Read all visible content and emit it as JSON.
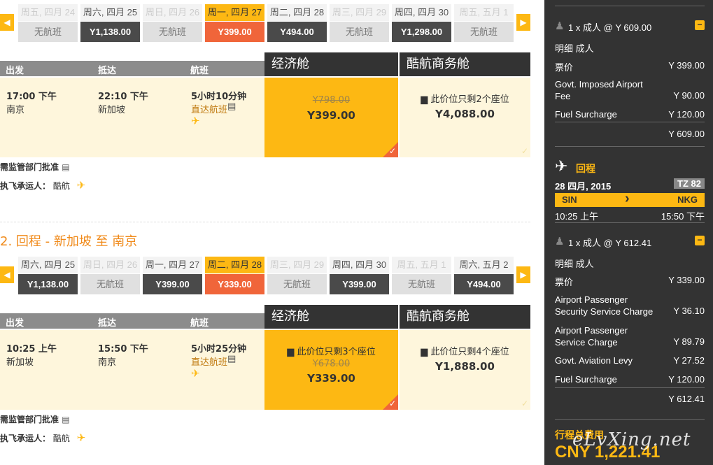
{
  "outbound": {
    "dates": [
      {
        "label": "周五, 四月 24",
        "value": "无航班",
        "state": "none"
      },
      {
        "label": "周六, 四月 25",
        "value": "Y1,138.00",
        "state": "fare"
      },
      {
        "label": "周日, 四月 26",
        "value": "无航班",
        "state": "none"
      },
      {
        "label": "周一, 四月 27",
        "value": "Y399.00",
        "state": "selected"
      },
      {
        "label": "周二, 四月 28",
        "value": "Y494.00",
        "state": "fare"
      },
      {
        "label": "周三, 四月 29",
        "value": "无航班",
        "state": "none"
      },
      {
        "label": "周四, 四月 30",
        "value": "Y1,298.00",
        "state": "fare"
      },
      {
        "label": "周五, 五月 1",
        "value": "无航班",
        "state": "none"
      }
    ],
    "headers": {
      "depart": "出发",
      "arrive": "抵达",
      "flight": "航班"
    },
    "cabins": {
      "economy": "经济舱",
      "business": "酷航商务舱"
    },
    "flight": {
      "depart_time": "17:00 下午",
      "depart_city": "南京",
      "arrive_time": "22:10 下午",
      "arrive_city": "新加坡",
      "duration": "5小时10分钟",
      "type": "直达航班"
    },
    "economy": {
      "old_price": "Y798.00",
      "price": "Y399.00"
    },
    "business": {
      "seats": "此价位只剩2个座位",
      "price": "Y4,088.00"
    },
    "approval": "需监管部门批准",
    "carrier_label": "执飞承运人：",
    "carrier": "酷航"
  },
  "return_section": {
    "title": "2. 回程 - 新加坡 至 南京"
  },
  "inbound": {
    "dates": [
      {
        "label": "周六, 四月 25",
        "value": "Y1,138.00",
        "state": "fare"
      },
      {
        "label": "周日, 四月 26",
        "value": "无航班",
        "state": "none"
      },
      {
        "label": "周一, 四月 27",
        "value": "Y399.00",
        "state": "fare"
      },
      {
        "label": "周二, 四月 28",
        "value": "Y339.00",
        "state": "selected"
      },
      {
        "label": "周三, 四月 29",
        "value": "无航班",
        "state": "none"
      },
      {
        "label": "周四, 四月 30",
        "value": "Y399.00",
        "state": "fare"
      },
      {
        "label": "周五, 五月 1",
        "value": "无航班",
        "state": "none"
      },
      {
        "label": "周六, 五月 2",
        "value": "Y494.00",
        "state": "fare"
      }
    ],
    "headers": {
      "depart": "出发",
      "arrive": "抵达",
      "flight": "航班"
    },
    "cabins": {
      "economy": "经济舱",
      "business": "酷航商务舱"
    },
    "flight": {
      "depart_time": "10:25 上午",
      "depart_city": "新加坡",
      "arrive_time": "15:50 下午",
      "arrive_city": "南京",
      "duration": "5小时25分钟",
      "type": "直达航班"
    },
    "economy": {
      "seats": "此价位只剩3个座位",
      "old_price": "Y678.00",
      "price": "Y339.00"
    },
    "business": {
      "seats": "此价位只剩4个座位",
      "price": "Y1,888.00"
    },
    "approval": "需监管部门批准",
    "carrier_label": "执飞承运人：",
    "carrier": "酷航"
  },
  "summary": {
    "outbound": {
      "pax": "1 x 成人 @ Y 609.00",
      "detail_label": "明细 成人",
      "items": [
        {
          "name": "票价",
          "amount": "Y 399.00"
        },
        {
          "name": "Govt. Imposed Airport Fee",
          "amount": "Y 90.00"
        },
        {
          "name": "Fuel Surcharge",
          "amount": "Y 120.00"
        }
      ],
      "total": "Y 609.00"
    },
    "return": {
      "title": "回程",
      "date": "28 四月, 2015",
      "flight_no": "TZ 82",
      "from": "SIN",
      "to": "NKG",
      "dep_time": "10:25 上午",
      "arr_time": "15:50 下午",
      "pax": "1 x 成人 @ Y 612.41",
      "detail_label": "明细 成人",
      "items": [
        {
          "name": "票价",
          "amount": "Y 339.00"
        },
        {
          "name": "Airport Passenger Security Service Charge",
          "amount": "Y 36.10"
        },
        {
          "name": "Airport Passenger Service Charge",
          "amount": "Y 89.79"
        },
        {
          "name": "Govt. Aviation Levy",
          "amount": "Y 27.52"
        },
        {
          "name": "Fuel Surcharge",
          "amount": "Y 120.00"
        }
      ],
      "total": "Y 612.41"
    },
    "grand_label": "行程总费用",
    "grand_total": "CNY 1,221.41",
    "watermark": "eLvXing.net",
    "colors": {
      "accent": "#fdb813",
      "selected": "#f0653a",
      "panel": "#333333"
    }
  }
}
